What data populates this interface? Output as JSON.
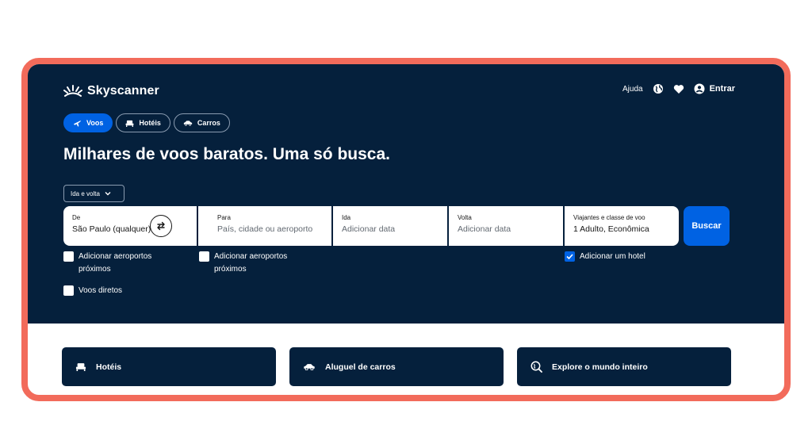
{
  "brand": {
    "name": "Skyscanner"
  },
  "topnav": {
    "help": "Ajuda",
    "login": "Entrar"
  },
  "tabs": [
    {
      "label": "Voos",
      "active": true
    },
    {
      "label": "Hotéis",
      "active": false
    },
    {
      "label": "Carros",
      "active": false
    }
  ],
  "headline": "Milhares de voos baratos. Uma só busca.",
  "trip_type": {
    "selected": "Ida e volta"
  },
  "search": {
    "from": {
      "label": "De",
      "value": "São Paulo (qualquer)"
    },
    "to": {
      "label": "Para",
      "placeholder": "País, cidade ou aeroporto"
    },
    "depart": {
      "label": "Ida",
      "placeholder": "Adicionar data"
    },
    "return": {
      "label": "Volta",
      "placeholder": "Adicionar data"
    },
    "travelers": {
      "label": "Viajantes e classe de voo",
      "value": "1 Adulto, Econômica"
    },
    "submit": "Buscar"
  },
  "options": {
    "nearby_from": {
      "label": "Adicionar aeroportos próximos",
      "checked": false
    },
    "nearby_to": {
      "label": "Adicionar aeroportos próximos",
      "checked": false
    },
    "add_hotel": {
      "label": "Adicionar um hotel",
      "checked": true
    },
    "direct": {
      "label": "Voos diretos",
      "checked": false
    }
  },
  "cards": [
    {
      "label": "Hotéis",
      "icon": "bed-icon"
    },
    {
      "label": "Aluguel de carros",
      "icon": "car-icon"
    },
    {
      "label": "Explore o mundo inteiro",
      "icon": "globe-search-icon"
    }
  ],
  "colors": {
    "hero_bg": "#05203c",
    "accent": "#0062e3",
    "frame": "#f26b5b"
  }
}
